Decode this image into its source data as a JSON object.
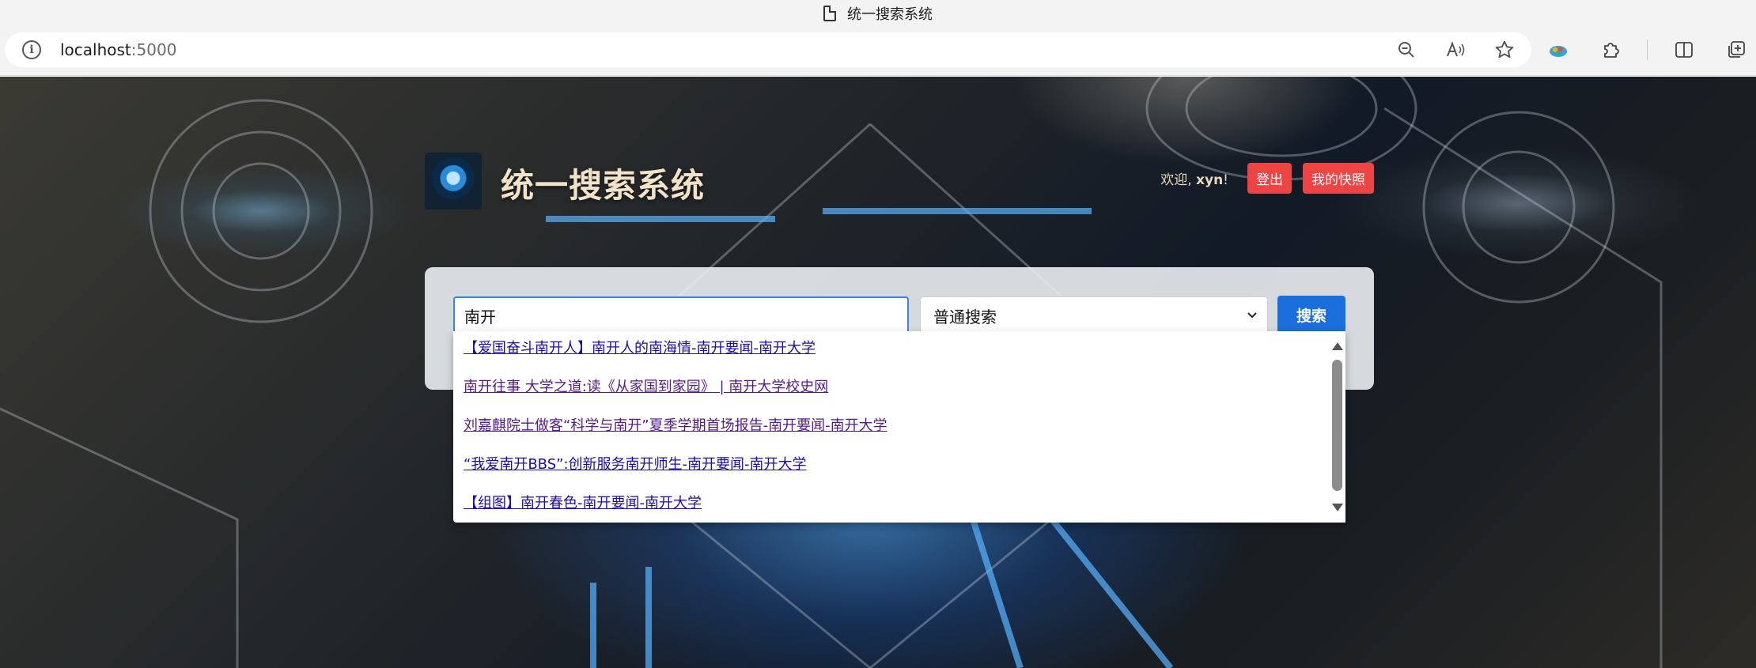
{
  "browser": {
    "tab_title": "统一搜索系统",
    "url_host": "localhost",
    "url_port": ":5000"
  },
  "header": {
    "site_title": "统一搜索系统",
    "welcome_prefix": "欢迎,",
    "username": "xyn",
    "welcome_suffix": "!",
    "logout_label": "登出",
    "snapshot_label": "我的快照"
  },
  "search": {
    "query": "南开",
    "mode_selected": "普通搜索",
    "submit_label": "搜索"
  },
  "suggestions": [
    {
      "text": "【爱国奋斗南开人】南开人的南海情-南开要闻-南开大学",
      "visited": false
    },
    {
      "text": "南开往事 大学之道:读《从家国到家园》 | 南开大学校史网",
      "visited": true
    },
    {
      "text": "刘嘉麒院士做客“科学与南开”夏季学期首场报告-南开要闻-南开大学",
      "visited": true
    },
    {
      "text": "“我爱南开BBS”:创新服务南开师生-南开要闻-南开大学",
      "visited": false
    },
    {
      "text": "【组图】南开春色-南开要闻-南开大学",
      "visited": false
    }
  ],
  "icons": {
    "tab": "document-icon",
    "site_info": "info-icon",
    "zoom": "zoom-out-icon",
    "read_aloud": "read-aloud-icon",
    "favorite": "star-icon",
    "extension_color": "color-extension-icon",
    "extensions": "puzzle-icon",
    "split_screen": "split-screen-icon",
    "collections": "collections-icon"
  },
  "colors": {
    "accent_blue": "#1a6fdc",
    "danger_red": "#ef4444",
    "title_cream": "#f1e3c9"
  }
}
